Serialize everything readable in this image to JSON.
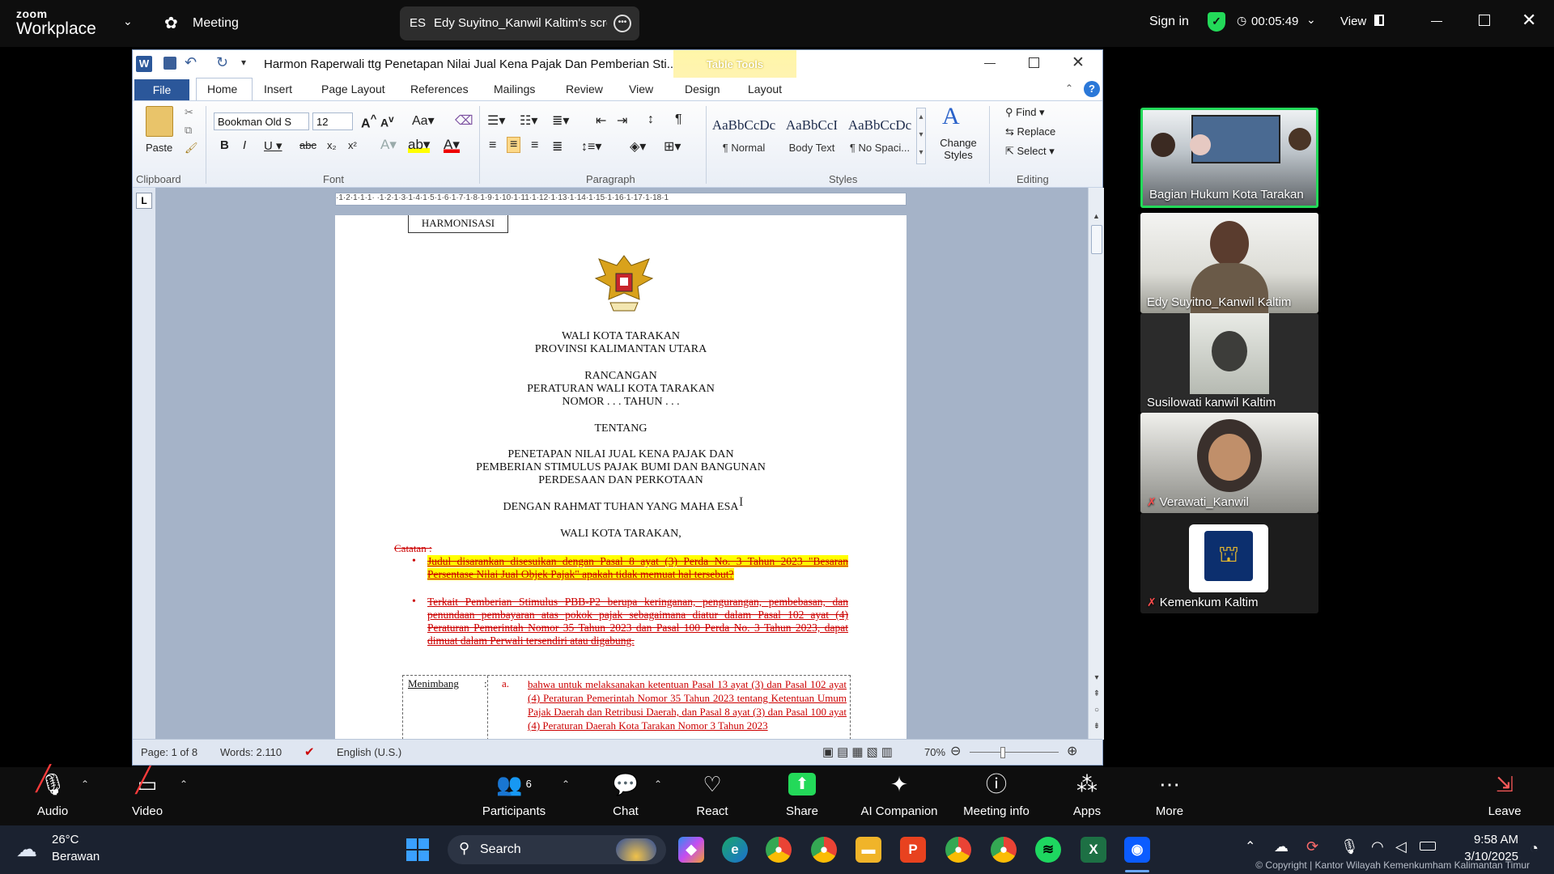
{
  "zoom_top": {
    "logo_line1": "zoom",
    "logo_line2": "Workplace",
    "meeting_label": "Meeting",
    "share_initials": "ES",
    "share_text": "Edy Suyitno_Kanwil Kaltim's screen",
    "sign_in": "Sign in",
    "timer": "00:05:49",
    "view_label": "View"
  },
  "word": {
    "title": "Harmon Raperwali ttg Penetapan Nilai Jual Kena Pajak Dan Pemberian Sti...",
    "context_tab": "Table Tools",
    "tabs": [
      "File",
      "Home",
      "Insert",
      "Page Layout",
      "References",
      "Mailings",
      "Review",
      "View",
      "Design",
      "Layout"
    ],
    "font_name": "Bookman Old S",
    "font_size": "12",
    "paste_label": "Paste",
    "groups": [
      "Clipboard",
      "Font",
      "Paragraph",
      "Styles",
      "Editing"
    ],
    "styles": [
      {
        "sample": "AaBbCcDc",
        "name": "¶ Normal"
      },
      {
        "sample": "AaBbCcI",
        "name": "Body Text"
      },
      {
        "sample": "AaBbCcDc",
        "name": "¶ No Spaci..."
      }
    ],
    "change_styles": "Change Styles",
    "editing": {
      "find": "Find",
      "replace": "Replace",
      "select": "Select"
    },
    "ruler_text": "·1·2·1·1·1· ·1·2·1·3·1·4·1·5·1·6·1·7·1·8·1·9·1·10·1·11·1·12·1·13·1·14·1·15·1·16·1·17·1·18·1",
    "status": {
      "page": "Page: 1 of 8",
      "words": "Words: 2.110",
      "language": "English (U.S.)",
      "zoom": "70%"
    }
  },
  "document": {
    "box_label": "HARMONISASI",
    "line1": "WALI KOTA TARAKAN",
    "line2": "PROVINSI KALIMANTAN UTARA",
    "line3": "RANCANGAN",
    "line4": "PERATURAN WALI KOTA TARAKAN",
    "line5": "NOMOR . . . TAHUN . . .",
    "line6": "TENTANG",
    "line7": "PENETAPAN NILAI JUAL KENA PAJAK DAN",
    "line8": "PEMBERIAN STIMULUS PAJAK BUMI DAN BANGUNAN",
    "line9": "PERDESAAN DAN PERKOTAAN",
    "line10": "DENGAN RAHMAT TUHAN YANG MAHA ESA",
    "line11": "WALI KOTA TARAKAN,",
    "catatan": "Catatan :",
    "note1": "Judul disarankan disesuikan dengan Pasal 8 ayat (3) Perda No. 3 Tahun 2023 \"Besaran Persentase Nilai Jual Objek Pajak\" apakah tidak memuat hal tersebut?",
    "note2": "Terkait Pemberian Stimulus PBB-P2 berupa keringanan, pengurangan, pembebasan, dan penundaan pembayaran atas pokok pajak sebagaimana diatur dalam Pasal 102 ayat (4) Peraturan Pemerintah Nomor 35 Tahun 2023 dan Pasal 100 Perda No. 3 Tahun 2023, dapat dimuat dalam Perwali tersendiri atau digabung.",
    "menimbang": "Menimbang",
    "colon": ":",
    "item_a": "a.",
    "menimbang_text": "bahwa untuk melaksanakan ketentuan Pasal 13 ayat (3) dan Pasal 102 ayat (4) Peraturan Pemerintah Nomor 35 Tahun 2023 tentang Ketentuan Umum Pajak Daerah dan Retribusi Daerah, dan Pasal 8 ayat (3) dan Pasal 100 ayat (4) Peraturan Daerah Kota Tarakan Nomor 3 Tahun 2023"
  },
  "participants": [
    {
      "name": "Bagian Hukum Kota Tarakan",
      "muted": false
    },
    {
      "name": "Edy Suyitno_Kanwil Kaltim",
      "muted": false
    },
    {
      "name": "Susilowati kanwil Kaltim",
      "muted": false
    },
    {
      "name": "Verawati_Kanwil",
      "muted": true
    },
    {
      "name": "Kemenkum Kaltim",
      "muted": true
    }
  ],
  "toolbar": {
    "audio": "Audio",
    "video": "Video",
    "participants": "Participants",
    "participants_count": "6",
    "chat": "Chat",
    "react": "React",
    "share": "Share",
    "ai": "AI Companion",
    "meeting_info": "Meeting info",
    "apps": "Apps",
    "more": "More",
    "leave": "Leave"
  },
  "taskbar": {
    "temp": "26°C",
    "weather": "Berawan",
    "search": "Search",
    "time": "9:58 AM",
    "date": "3/10/2025",
    "copyright": "© Copyright | Kantor Wilayah Kemenkumham Kalimantan Timur"
  },
  "colors": {
    "accent_green": "#23d959",
    "word_blue": "#2b579a",
    "highlight": "#ffff00"
  }
}
